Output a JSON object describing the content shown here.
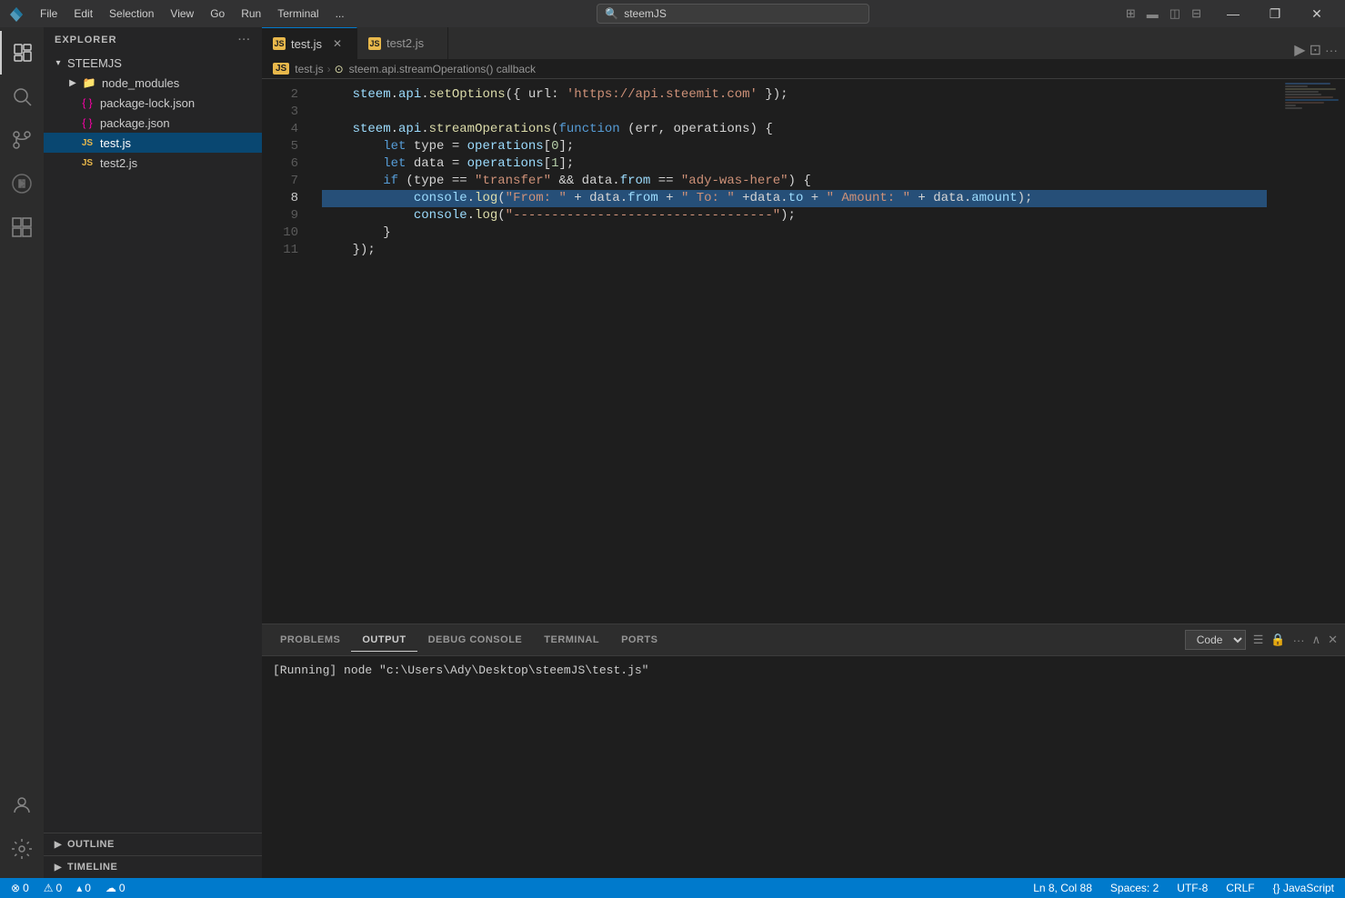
{
  "titlebar": {
    "icon": "⬡",
    "menus": [
      "File",
      "Edit",
      "Selection",
      "View",
      "Go",
      "Run",
      "Terminal",
      "..."
    ],
    "search_placeholder": "steemJS",
    "search_icon": "🔍",
    "window_controls": [
      "⊟",
      "❐",
      "✕"
    ]
  },
  "activity_bar": {
    "items": [
      {
        "name": "explorer",
        "icon": "files",
        "active": true
      },
      {
        "name": "search",
        "icon": "search"
      },
      {
        "name": "source-control",
        "icon": "git"
      },
      {
        "name": "run-debug",
        "icon": "debug"
      },
      {
        "name": "extensions",
        "icon": "extensions"
      }
    ],
    "bottom_items": [
      {
        "name": "accounts",
        "icon": "account"
      },
      {
        "name": "settings",
        "icon": "gear"
      }
    ]
  },
  "sidebar": {
    "title": "Explorer",
    "more_icon": "···",
    "tree": {
      "root": {
        "label": "STEEMJS",
        "expanded": true,
        "children": [
          {
            "label": "node_modules",
            "icon": "folder",
            "type": "folder",
            "expanded": false
          },
          {
            "label": "package-lock.json",
            "icon": "json",
            "type": "file"
          },
          {
            "label": "package.json",
            "icon": "json",
            "type": "file"
          },
          {
            "label": "test.js",
            "icon": "js",
            "type": "file",
            "active": true
          },
          {
            "label": "test2.js",
            "icon": "js",
            "type": "file"
          }
        ]
      }
    },
    "sections": [
      {
        "label": "OUTLINE"
      },
      {
        "label": "TIMELINE"
      }
    ]
  },
  "editor": {
    "tabs": [
      {
        "label": "test.js",
        "active": true,
        "icon": "JS",
        "closeable": true
      },
      {
        "label": "test2.js",
        "active": false,
        "icon": "JS",
        "closeable": false
      }
    ],
    "breadcrumb": [
      {
        "label": "test.js"
      },
      {
        "label": "steem.api.streamOperations() callback"
      }
    ],
    "lines": [
      {
        "num": 2,
        "content": "steem_api_setoptions",
        "tokens": [
          {
            "text": "    steem",
            "cls": "c-blue2"
          },
          {
            "text": ".",
            "cls": "c-op"
          },
          {
            "text": "api",
            "cls": "c-blue2"
          },
          {
            "text": ".",
            "cls": "c-op"
          },
          {
            "text": "setOptions",
            "cls": "c-yellow"
          },
          {
            "text": "({ url: ",
            "cls": "c-white"
          },
          {
            "text": "'https://api.steemit.com'",
            "cls": "c-string"
          },
          {
            "text": " });",
            "cls": "c-white"
          }
        ]
      },
      {
        "num": 3,
        "content": "",
        "tokens": []
      },
      {
        "num": 4,
        "content": "steem_api_stream",
        "tokens": [
          {
            "text": "    steem",
            "cls": "c-blue2"
          },
          {
            "text": ".",
            "cls": "c-op"
          },
          {
            "text": "api",
            "cls": "c-blue2"
          },
          {
            "text": ".",
            "cls": "c-op"
          },
          {
            "text": "streamOperations",
            "cls": "c-yellow"
          },
          {
            "text": "(",
            "cls": "c-white"
          },
          {
            "text": "function",
            "cls": "c-keyword2"
          },
          {
            "text": " (err, operations) {",
            "cls": "c-white"
          }
        ]
      },
      {
        "num": 5,
        "content": "let_type",
        "tokens": [
          {
            "text": "        ",
            "cls": "c-white"
          },
          {
            "text": "let",
            "cls": "c-keyword2"
          },
          {
            "text": " type = operations",
            "cls": "c-blue2"
          },
          {
            "text": "[",
            "cls": "c-white"
          },
          {
            "text": "0",
            "cls": "c-num"
          },
          {
            "text": "];",
            "cls": "c-white"
          }
        ]
      },
      {
        "num": 6,
        "content": "let_data",
        "tokens": [
          {
            "text": "        ",
            "cls": "c-white"
          },
          {
            "text": "let",
            "cls": "c-keyword2"
          },
          {
            "text": " data = operations",
            "cls": "c-blue2"
          },
          {
            "text": "[",
            "cls": "c-white"
          },
          {
            "text": "1",
            "cls": "c-num"
          },
          {
            "text": "];",
            "cls": "c-white"
          }
        ]
      },
      {
        "num": 7,
        "content": "if_type",
        "tokens": [
          {
            "text": "        ",
            "cls": "c-white"
          },
          {
            "text": "if",
            "cls": "c-keyword2"
          },
          {
            "text": " (type == ",
            "cls": "c-white"
          },
          {
            "text": "\"transfer\"",
            "cls": "c-string"
          },
          {
            "text": " && data.",
            "cls": "c-white"
          },
          {
            "text": "from",
            "cls": "c-blue2"
          },
          {
            "text": " == ",
            "cls": "c-white"
          },
          {
            "text": "\"ady-was-here\"",
            "cls": "c-string"
          },
          {
            "text": ") {",
            "cls": "c-white"
          }
        ]
      },
      {
        "num": 8,
        "content": "console_log_from",
        "highlight": true,
        "tokens": [
          {
            "text": "            console",
            "cls": "c-blue2"
          },
          {
            "text": ".",
            "cls": "c-op"
          },
          {
            "text": "log",
            "cls": "c-yellow"
          },
          {
            "text": "(",
            "cls": "c-white"
          },
          {
            "text": "\"From: \"",
            "cls": "c-string"
          },
          {
            "text": " + data.",
            "cls": "c-white"
          },
          {
            "text": "from",
            "cls": "c-blue2"
          },
          {
            "text": " + ",
            "cls": "c-white"
          },
          {
            "text": "\" To: \"",
            "cls": "c-string"
          },
          {
            "text": " +data.",
            "cls": "c-white"
          },
          {
            "text": "to",
            "cls": "c-blue2"
          },
          {
            "text": " + ",
            "cls": "c-white"
          },
          {
            "text": "\" Amount: \"",
            "cls": "c-string"
          },
          {
            "text": " + data.",
            "cls": "c-white"
          },
          {
            "text": "amount",
            "cls": "c-blue2"
          },
          {
            "text": ");",
            "cls": "c-white"
          }
        ]
      },
      {
        "num": 9,
        "content": "console_log_dashes",
        "tokens": [
          {
            "text": "            console",
            "cls": "c-blue2"
          },
          {
            "text": ".",
            "cls": "c-op"
          },
          {
            "text": "log",
            "cls": "c-yellow"
          },
          {
            "text": "(",
            "cls": "c-white"
          },
          {
            "text": "\"----------------------------------\"",
            "cls": "c-string"
          },
          {
            "text": ");",
            "cls": "c-white"
          }
        ]
      },
      {
        "num": 10,
        "content": "close_brace_if",
        "tokens": [
          {
            "text": "        }",
            "cls": "c-white"
          }
        ]
      },
      {
        "num": 11,
        "content": "close_brace_fn",
        "tokens": [
          {
            "text": "    });",
            "cls": "c-white"
          }
        ]
      }
    ]
  },
  "panel": {
    "tabs": [
      {
        "label": "PROBLEMS",
        "active": false
      },
      {
        "label": "OUTPUT",
        "active": true
      },
      {
        "label": "DEBUG CONSOLE",
        "active": false
      },
      {
        "label": "TERMINAL",
        "active": false
      },
      {
        "label": "PORTS",
        "active": false
      }
    ],
    "output_select": "Code",
    "output_content": "[Running] node \"c:\\Users\\Ady\\Desktop\\steemJS\\test.js\"",
    "actions": [
      "list-icon",
      "lock-icon",
      "more-icon",
      "up-icon",
      "close-icon"
    ]
  },
  "status_bar": {
    "left": [
      {
        "icon": "⊗",
        "text": "0"
      },
      {
        "icon": "⚠",
        "text": "0"
      },
      {
        "icon": "▴",
        "text": "0"
      },
      {
        "icon": "☁",
        "text": "0"
      }
    ],
    "right": [
      {
        "text": "Ln 8, Col 88"
      },
      {
        "text": "Spaces: 2"
      },
      {
        "text": "UTF-8"
      },
      {
        "text": "CRLF"
      },
      {
        "text": "{} JavaScript"
      }
    ]
  }
}
